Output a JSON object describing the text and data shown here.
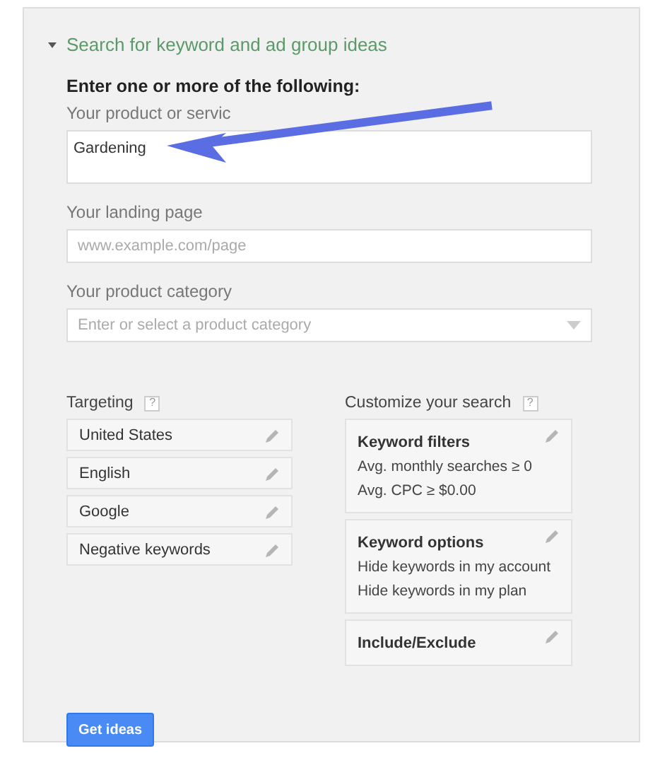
{
  "section": {
    "title": "Search for keyword and ad group ideas",
    "expanded": true
  },
  "form": {
    "heading": "Enter one or more of the following:",
    "fields": [
      {
        "kind": "textarea",
        "label": "Your product or servic",
        "value": "Gardening"
      },
      {
        "kind": "text",
        "label": "Your landing page",
        "placeholder": "www.example.com/page"
      },
      {
        "kind": "dropdown",
        "label": "Your product category",
        "placeholder": "Enter or select a product category"
      }
    ]
  },
  "targeting": {
    "title": "Targeting",
    "help": "?",
    "items": [
      "United States",
      "English",
      "Google",
      "Negative keywords"
    ]
  },
  "customize": {
    "title": "Customize your search",
    "help": "?",
    "cards": [
      {
        "title": "Keyword filters",
        "lines": [
          "Avg. monthly searches ≥ 0",
          "Avg. CPC ≥ $0.00"
        ]
      },
      {
        "title": "Keyword options",
        "lines": [
          "Hide keywords in my account",
          "Hide keywords in my plan"
        ]
      },
      {
        "title": "Include/Exclude"
      }
    ]
  },
  "button": "Get ideas"
}
